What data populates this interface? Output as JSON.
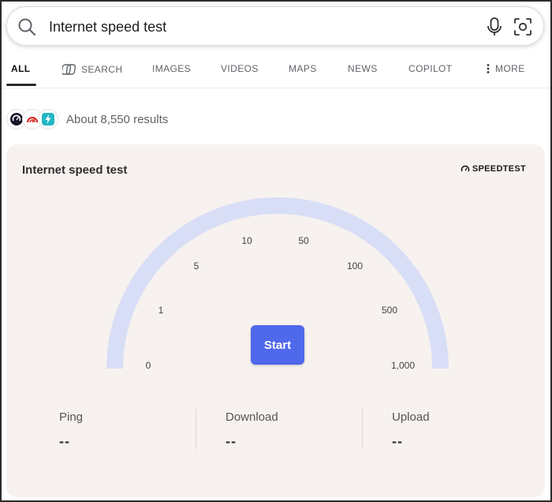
{
  "search": {
    "query": "Internet speed test"
  },
  "tabs": [
    {
      "label": "ALL",
      "active": true
    },
    {
      "label": "SEARCH",
      "icon": "copilot-search-icon"
    },
    {
      "label": "IMAGES"
    },
    {
      "label": "VIDEOS"
    },
    {
      "label": "MAPS"
    },
    {
      "label": "NEWS"
    },
    {
      "label": "COPILOT"
    },
    {
      "label": "MORE",
      "icon": "more-vertical-icon"
    }
  ],
  "results": {
    "count_text": "About 8,550 results"
  },
  "speedtest": {
    "title": "Internet speed test",
    "brand": "SPEEDTEST",
    "ticks": [
      "0",
      "1",
      "5",
      "10",
      "50",
      "100",
      "500",
      "1,000"
    ],
    "start_label": "Start",
    "metrics": [
      {
        "label": "Ping",
        "value": "--"
      },
      {
        "label": "Download",
        "value": "--"
      },
      {
        "label": "Upload",
        "value": "--"
      }
    ]
  },
  "colors": {
    "gauge_arc": "#d9def7",
    "start_button": "#4f68ec",
    "card_bg": "#f7f2ef"
  }
}
